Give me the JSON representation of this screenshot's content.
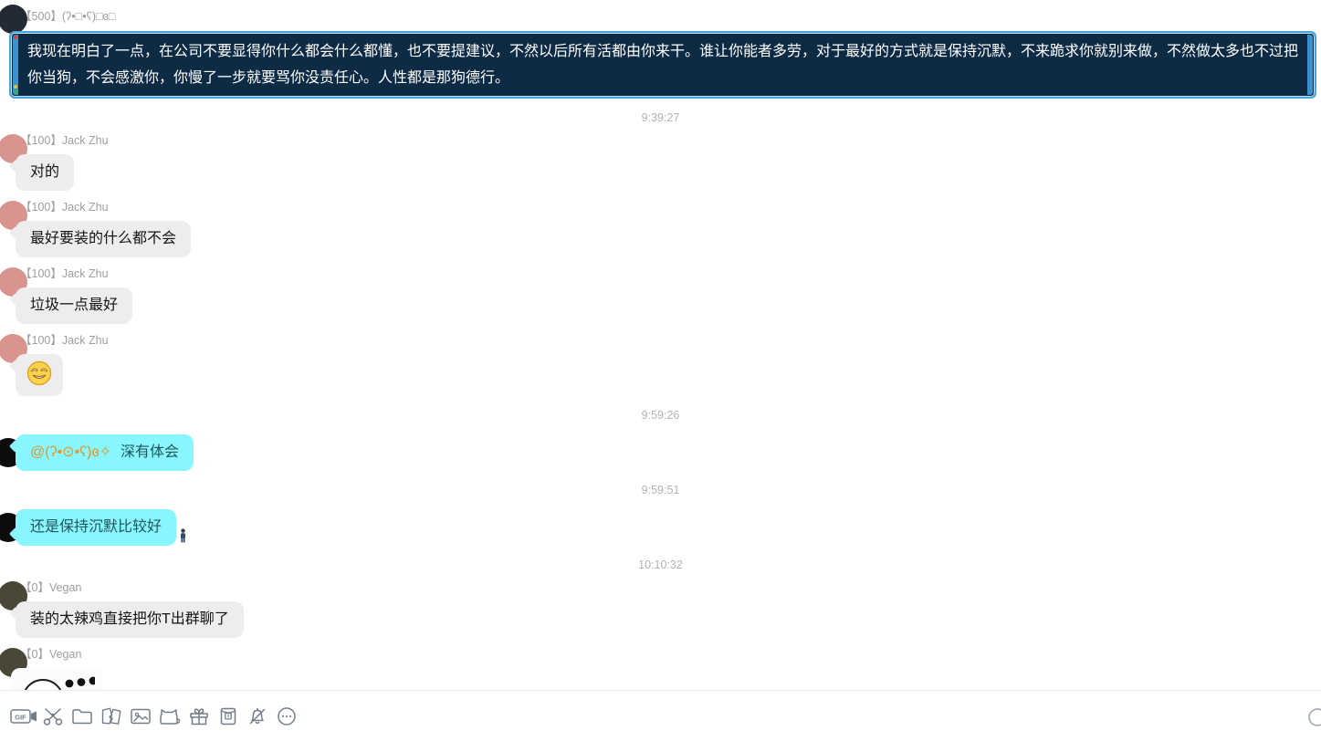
{
  "top_message": {
    "sender": "【500】(ʔ•□•ʕ)□ɞ□",
    "text": "我现在明白了一点，在公司不要显得你什么都会什么都懂，也不要提建议，不然以后所有活都由你来干。谁让你能者多劳，对于最好的方式就是保持沉默，不来跪求你就别来做，不然做太多也不过把你当狗，不会感激你，你慢了一步就要骂你没责任心。人性都是那狗德行。"
  },
  "timestamps": {
    "t1": "9:39:27",
    "t2": "9:59:26",
    "t3": "9:59:51",
    "t4": "10:10:32"
  },
  "jack": {
    "label": "【100】Jack Zhu",
    "msg1": "对的",
    "msg2": "最好要装的什么都不会",
    "msg3": "垃圾一点最好",
    "emoji_icon": "sly-smile-emoji"
  },
  "self_user": {
    "mention": "@(ʔ•⊙•ʕ)ɞ✧",
    "msg1": "深有体会",
    "msg2": "还是保持沉默比较好",
    "person_icon": "tiny-person-sticker"
  },
  "vegan": {
    "label": "【0】Vegan",
    "msg1": "装的太辣鸡直接把你T出群聊了",
    "sticker_icon": "annoyed-face-on-table-sticker"
  },
  "toolbar": {
    "gif_label": "GIF",
    "icons": [
      "gif-video-icon",
      "scissors-icon",
      "folder-icon",
      "torn-photo-icon",
      "image-icon",
      "cat-pack-icon",
      "gift-icon",
      "red-packet-icon",
      "bell-off-icon",
      "more-icon",
      "history-icon"
    ]
  },
  "colors": {
    "selected_bg": "#0e2b45",
    "selected_border": "#4aa5da",
    "cyan_bubble": "#87f6ff",
    "gray_bubble": "#ededed",
    "mention_orange": "#e1972f",
    "icon_gray": "#737d89"
  }
}
